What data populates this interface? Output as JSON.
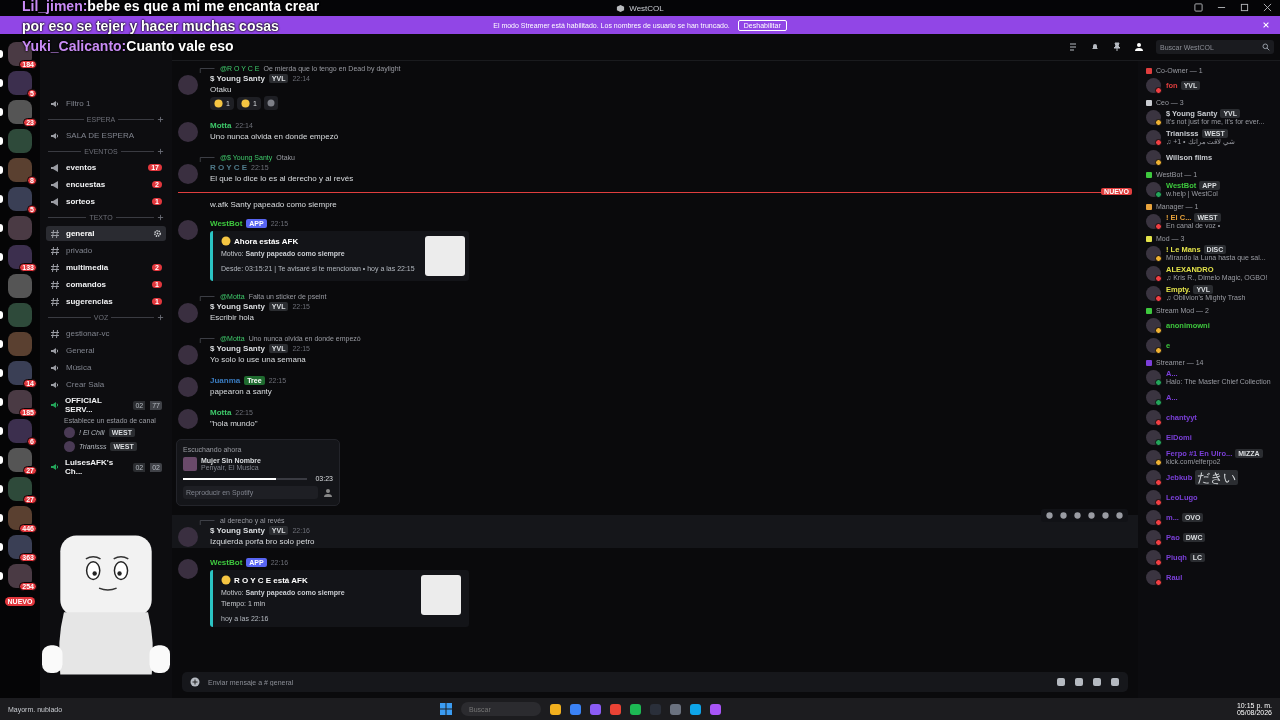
{
  "window": {
    "title": "WestCOL"
  },
  "overlay_chat": [
    {
      "user": "Lil_jimen:",
      "text": "bebe es que a mi me encanta crear"
    },
    {
      "text": "por eso se tejer y hacer muchas cosas"
    },
    {
      "user": "Yuki_Calicanto:",
      "text": "Cuanto vale eso"
    }
  ],
  "streamer_banner": {
    "text": "El modo Streamer está habilitado. Los nombres de usuario se han truncado.",
    "button": "Deshabilitar"
  },
  "search": {
    "placeholder": "Buscar WestCOL"
  },
  "servers": [
    {
      "unread": true,
      "badge": "184"
    },
    {
      "unread": true,
      "badge": "5"
    },
    {
      "unread": true,
      "badge": "23"
    },
    {
      "unread": true
    },
    {
      "unread": true,
      "badge": "8"
    },
    {
      "unread": true,
      "badge": "5"
    },
    {
      "unread": true
    },
    {
      "unread": true,
      "badge": "133"
    },
    {
      "unread": false
    },
    {
      "unread": true
    },
    {
      "unread": true
    },
    {
      "unread": true,
      "badge": "14"
    },
    {
      "unread": true,
      "badge": "185"
    },
    {
      "unread": true,
      "badge": "6"
    },
    {
      "unread": true,
      "badge": "27"
    },
    {
      "unread": true,
      "badge": "27"
    },
    {
      "unread": true,
      "badge": "446"
    },
    {
      "unread": true,
      "badge": "363"
    },
    {
      "unread": true,
      "badge": "254"
    }
  ],
  "rail_new_badge": "NUEVO",
  "channels": [
    {
      "kind": "voice",
      "name": "Filtro 1",
      "unread": false,
      "selected": false
    },
    {
      "kind": "category",
      "name": "ESPERA"
    },
    {
      "kind": "voice",
      "name": "SALA DE ESPERA",
      "unread": false,
      "selected": false
    },
    {
      "kind": "category",
      "name": "EVENTOS"
    },
    {
      "kind": "announce",
      "name": "eventos",
      "unread": true,
      "selected": false,
      "badge": "17"
    },
    {
      "kind": "announce",
      "name": "encuestas",
      "unread": true,
      "selected": false,
      "badge": "2"
    },
    {
      "kind": "announce",
      "name": "sorteos",
      "unread": true,
      "selected": false,
      "badge": "1"
    },
    {
      "kind": "category",
      "name": "TEXTO"
    },
    {
      "kind": "text",
      "name": "general",
      "unread": true,
      "selected": true
    },
    {
      "kind": "text",
      "name": "privado",
      "unread": false,
      "selected": false
    },
    {
      "kind": "text",
      "name": "multimedia",
      "unread": true,
      "selected": false,
      "badge": "2"
    },
    {
      "kind": "text",
      "name": "comandos",
      "unread": true,
      "selected": false,
      "badge": "1"
    },
    {
      "kind": "text",
      "name": "sugerencias",
      "unread": true,
      "selected": false,
      "badge": "1"
    },
    {
      "kind": "category",
      "name": "VOZ"
    },
    {
      "kind": "text",
      "name": "gestionar-vc",
      "unread": false,
      "selected": false
    },
    {
      "kind": "voice",
      "name": "General",
      "unread": false,
      "selected": false
    },
    {
      "kind": "voice",
      "name": "Música",
      "unread": false,
      "selected": false
    },
    {
      "kind": "voice",
      "name": "Crear Sala",
      "unread": false,
      "selected": false
    },
    {
      "kind": "live_voice",
      "name": "OFFICIAL SERV...",
      "count": "02",
      "limit": "77",
      "status": "Establece un estado de canal",
      "users": [
        {
          "name": "! El Chili",
          "tag": "WEST"
        },
        {
          "name": "Trianisss",
          "tag": "WEST"
        }
      ]
    },
    {
      "kind": "live_voice",
      "name": "LuisesAFK's Ch...",
      "count": "02",
      "limit": "02"
    }
  ],
  "messages": [
    {
      "kind": "message",
      "color": "#dbdee1",
      "reply": {
        "user": "@R O Y C E",
        "text": "Oe mierda que lo tengo en Dead by daylight"
      },
      "author": "$ Young Santy",
      "tag": {
        "kind": "clan",
        "text": "YVL"
      },
      "time": "22:14",
      "text": "Otaku",
      "reactions": [
        "1",
        "1"
      ]
    },
    {
      "kind": "message",
      "color": "#3ec86a",
      "author": "Motta",
      "time": "22:14",
      "text": "Uno nunca olvida en donde empezó"
    },
    {
      "kind": "message",
      "color": "#4f7a8a",
      "reply": {
        "user": "@$ Young Santy",
        "text": "Otaku"
      },
      "author": "R O Y C E",
      "time": "22:15",
      "text": "El que lo dice lo es al derecho y al revés"
    },
    {
      "kind": "divider",
      "label": "NUEVO"
    },
    {
      "kind": "continuation",
      "text": "w.afk Santy papeado como siempre"
    },
    {
      "kind": "message",
      "color": "#3ec83e",
      "author": "WestBot",
      "tag": {
        "kind": "app",
        "text": "APP"
      },
      "time": "22:15",
      "embed": {
        "title": "Ahora estás AFK",
        "lines": [
          "Motivo: **Santy papeado como siempre**"
        ],
        "footer": "Desde: 03:15:21 | Te avisaré si te mencionan • hoy a las 22:15"
      }
    },
    {
      "kind": "message",
      "color": "#dbdee1",
      "reply": {
        "user": "@Motta",
        "text": "Falta un sticker de pseint"
      },
      "author": "$ Young Santy",
      "tag": {
        "kind": "clan",
        "text": "YVL"
      },
      "time": "22:15",
      "text": "Escribir hola"
    },
    {
      "kind": "message",
      "color": "#dbdee1",
      "reply": {
        "user": "@Motta",
        "text": "Uno nunca olvida en donde empezó"
      },
      "author": "$ Young Santy",
      "tag": {
        "kind": "clan",
        "text": "YVL"
      },
      "time": "22:15",
      "text": "Yo solo lo use una semana"
    },
    {
      "kind": "message",
      "color": "#3a7bbf",
      "author": "Juanma",
      "tag": {
        "kind": "guild",
        "text": "Tree"
      },
      "time": "22:15",
      "text": "papearon a santy"
    },
    {
      "kind": "message",
      "color": "#3ec86a",
      "author": "Motta",
      "time": "22:15",
      "text": "\"hola mundo\""
    },
    {
      "kind": "now_playing",
      "heading": "Escuchando ahora",
      "track": "Mujer Sin Nombre",
      "artist": "Penyair, El Musica",
      "time": "03:23",
      "level": 0.75,
      "button": "Reproducir en Spotify"
    },
    {
      "kind": "message",
      "color": "#dbdee1",
      "hovered": true,
      "reply": {
        "text": "al derecho y al revés"
      },
      "author": "$ Young Santy",
      "tag": {
        "kind": "clan",
        "text": "YVL"
      },
      "time": "22:16",
      "text": "Izquierda porfa bro solo petro"
    },
    {
      "kind": "message",
      "color": "#3ec83e",
      "author": "WestBot",
      "tag": {
        "kind": "app",
        "text": "APP"
      },
      "time": "22:16",
      "embed": {
        "title": "R O Y C E está AFK",
        "lines": [
          "Motivo: **Santy papeado como siempre**",
          "Tiempo: 1 min"
        ],
        "footer": "hoy a las 22:16"
      }
    }
  ],
  "composer": {
    "placeholder": "Enviar mensaje a # general"
  },
  "member_groups": [
    {
      "name": "Co-Owner — 1",
      "color": "#e03e3e",
      "members": [
        {
          "name": "fon",
          "tag": "YVL",
          "color": "#f23f43"
        }
      ]
    },
    {
      "name": "Ceo — 3",
      "color": "#c9ccd1",
      "members": [
        {
          "name": "$ Young Santy",
          "tag": "YVL",
          "activity": "It's not just for me, it's for ever...",
          "color": "#f0b232"
        },
        {
          "name": "Trianisss",
          "tag": "WEST",
          "activity": "♫ +1 • شي لاقت مراتك",
          "color": "#f23f43"
        },
        {
          "name": "Willson films",
          "color": "#f0b232"
        }
      ]
    },
    {
      "name": "WestBot — 1",
      "color": "#3ec83e",
      "members": [
        {
          "name": "WestBot",
          "tag": "APP",
          "activity": "w.help | WestCol",
          "color": "#23a55a"
        }
      ]
    },
    {
      "name": "Manager — 1",
      "color": "#e8a33c",
      "members": [
        {
          "name": "! El C...",
          "tag": "WEST",
          "activity": "En canal de voz •",
          "color": "#f23f43"
        }
      ]
    },
    {
      "name": "Mod — 3",
      "color": "#e3e34a",
      "members": [
        {
          "name": "! Le Mans",
          "tag": "DISC",
          "activity": "Mirando la Luna hasta que sal...",
          "color": "#f0b232"
        },
        {
          "name": "ALEXANDRO",
          "activity": "♫ Kris R., Dimelo Magic, OGBO!",
          "color": "#f23f43"
        },
        {
          "name": "Empty.",
          "tag": "YVL",
          "activity": "♫ Oblivion's Mighty Trash",
          "color": "#f23f43"
        }
      ]
    },
    {
      "name": "Stream Mod — 2",
      "color": "#3ec83e",
      "members": [
        {
          "name": "anonimowni",
          "color": "#f0b232"
        },
        {
          "name": "e",
          "color": "#f0b232"
        }
      ]
    },
    {
      "name": "Streamer — 14",
      "color": "#7b3fd9",
      "members": [
        {
          "name": "A...",
          "activity": "Halo: The Master Chief Collection",
          "color": "#23a55a"
        },
        {
          "name": "A...",
          "color": "#23a55a"
        },
        {
          "name": "chantyyt",
          "color": "#f23f43"
        },
        {
          "name": "ElDomi",
          "color": "#23a55a"
        },
        {
          "name": "Ferpo #1 En Ulro...",
          "tag": "MIZZA",
          "activity": "kick.com/elferpo2",
          "color": "#f0b232"
        },
        {
          "name": "Jebkub",
          "tag": "だきい",
          "color": "#f23f43"
        },
        {
          "name": "LeoLugo",
          "color": "#f23f43"
        },
        {
          "name": "m...",
          "tag": "OVO",
          "color": "#f23f43"
        },
        {
          "name": "Pao",
          "tag": "DWC",
          "color": "#f23f43"
        },
        {
          "name": "Piuqh",
          "tag": "LC",
          "color": "#f23f43"
        },
        {
          "name": "Raul",
          "color": "#f23f43"
        }
      ]
    }
  ],
  "taskbar": {
    "weather": "Mayorm. nublado",
    "search_placeholder": "Buscar",
    "time": "10:15 p. m.",
    "date": "05/08/2026"
  }
}
